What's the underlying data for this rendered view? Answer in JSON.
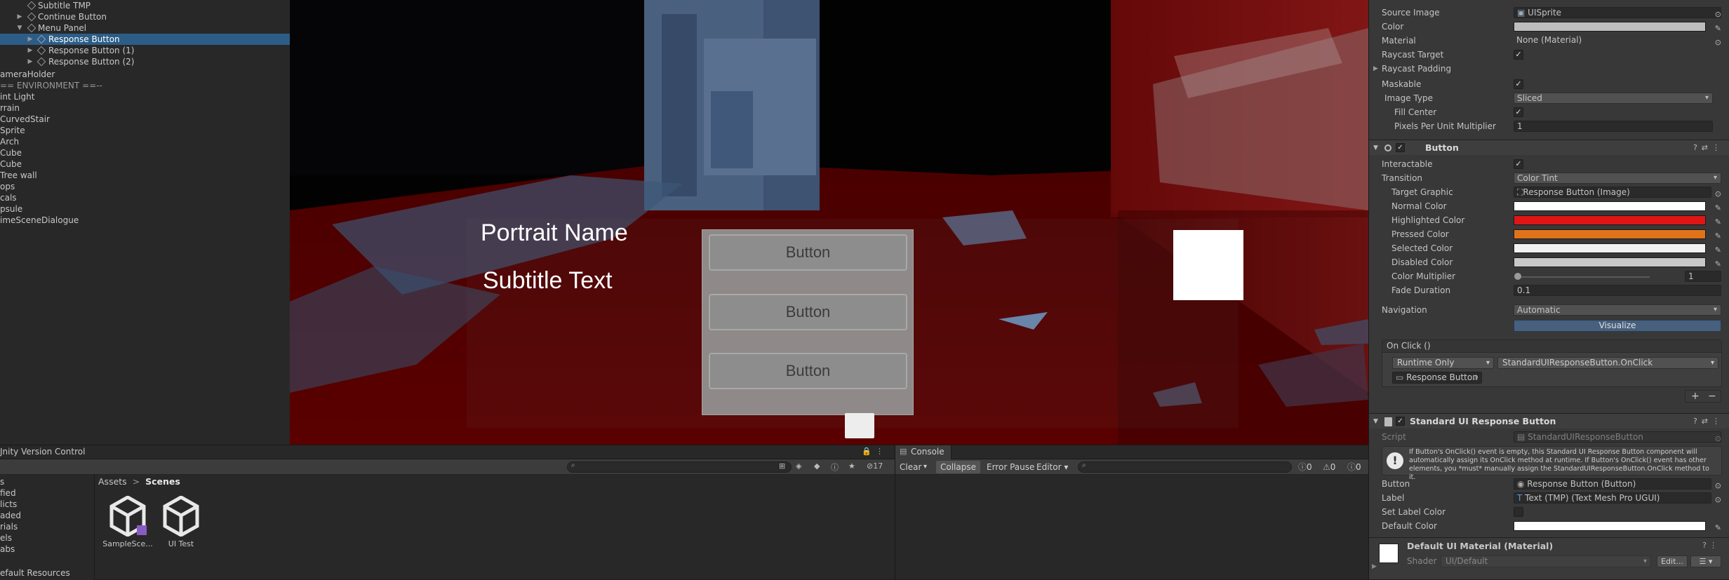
{
  "hierarchy": {
    "items": [
      {
        "label": "Subtitle TMP"
      },
      {
        "label": "Continue Button"
      },
      {
        "label": "Menu Panel"
      },
      {
        "label": "Response Button"
      },
      {
        "label": "Response Button (1)"
      },
      {
        "label": "Response Button (2)"
      },
      {
        "label": "ameraHolder"
      },
      {
        "label": "== ENVIRONMENT ==--"
      },
      {
        "label": "int Light"
      },
      {
        "label": "rrain"
      },
      {
        "label": "CurvedStair"
      },
      {
        "label": "Sprite"
      },
      {
        "label": "Arch"
      },
      {
        "label": "Cube"
      },
      {
        "label": "Cube"
      },
      {
        "label": "Tree wall"
      },
      {
        "label": "ops"
      },
      {
        "label": "cals"
      },
      {
        "label": "psule"
      },
      {
        "label": "imeSceneDialogue"
      }
    ]
  },
  "scene": {
    "portrait_name": "Portrait Name",
    "subtitle_text": "Subtitle Text",
    "buttons": [
      "Button",
      "Button",
      "Button"
    ]
  },
  "inspector": {
    "image": {
      "source_image_label": "Source Image",
      "source_image_value": "UISprite",
      "color_label": "Color",
      "material_label": "Material",
      "material_value": "None (Material)",
      "raycast_target_label": "Raycast Target",
      "raycast_padding_label": "Raycast Padding",
      "maskable_label": "Maskable",
      "image_type_label": "Image Type",
      "image_type_value": "Sliced",
      "fill_center_label": "Fill Center",
      "ppu_label": "Pixels Per Unit Multiplier",
      "ppu_value": "1"
    },
    "button": {
      "title": "Button",
      "interactable_label": "Interactable",
      "transition_label": "Transition",
      "transition_value": "Color Tint",
      "target_graphic_label": "Target Graphic",
      "target_graphic_value": "Response Button (Image)",
      "normal_label": "Normal Color",
      "highlighted_label": "Highlighted Color",
      "pressed_label": "Pressed Color",
      "selected_label": "Selected Color",
      "disabled_label": "Disabled Color",
      "multiplier_label": "Color Multiplier",
      "multiplier_value": "1",
      "fade_label": "Fade Duration",
      "fade_value": "0.1",
      "navigation_label": "Navigation",
      "navigation_value": "Automatic",
      "visualize_label": "Visualize",
      "onclick_label": "On Click ()",
      "runtime_value": "Runtime Only",
      "function_value": "StandardUIResponseButton.OnClick",
      "object_value": "Response Button",
      "add_label": "+",
      "remove_label": "−",
      "colors": {
        "normal": "#ffffff",
        "highlighted": "#e01616",
        "pressed": "#e0731a",
        "selected": "#f2f2f2",
        "disabled": "#c8c8c8"
      }
    },
    "standard": {
      "title": "Standard UI Response Button",
      "script_label": "Script",
      "script_value": "StandardUIResponseButton",
      "help_text": "If Button's OnClick() event is empty, this Standard UI Response Button component will automatically assign its OnClick method at runtime. If Button's OnClick() event has other elements, you *must* manually assign the StandardUIResponseButton.OnClick method to it.",
      "button_label": "Button",
      "button_value": "Response Button (Button)",
      "label_label": "Label",
      "label_value": "Text (TMP) (Text Mesh Pro UGUI)",
      "set_label_color_label": "Set Label Color",
      "default_color_label": "Default Color"
    },
    "material": {
      "title": "Default UI Material (Material)",
      "shader_label": "Shader",
      "shader_value": "UI/Default",
      "edit_label": "Edit..."
    }
  },
  "project": {
    "tab_label": "Jnity Version Control",
    "breadcrumb_root": "Assets",
    "breadcrumb_sep": ">",
    "breadcrumb_current": "Scenes",
    "hidden_count": "17",
    "tree": [
      "s",
      "fied",
      "licts",
      "aded",
      "rials",
      "els",
      "abs",
      "efault Resources"
    ],
    "assets": [
      {
        "label": "SampleSce..."
      },
      {
        "label": "UI Test"
      }
    ]
  },
  "console": {
    "tab_label": "Console",
    "clear_label": "Clear",
    "collapse_label": "Collapse",
    "error_pause_label": "Error Pause",
    "editor_label": "Editor",
    "count_logs": "0",
    "count_warnings": "0",
    "count_errors": "0"
  }
}
